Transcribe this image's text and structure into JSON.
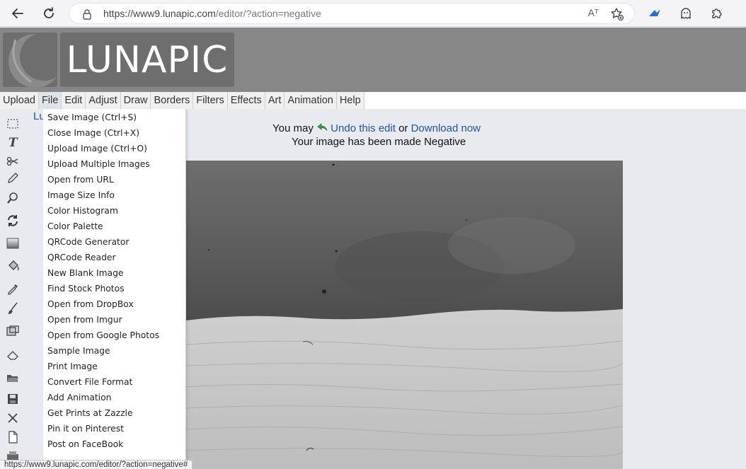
{
  "browser": {
    "url_host": "https://www9.lunapic.com",
    "url_path": "/editor/?action=negative",
    "reader_icon_text": "Aᵀ",
    "status_url": "https://www9.lunapic.com/editor/?action=negative#"
  },
  "logo": {
    "text": "LUNAPIC"
  },
  "menubar": {
    "items": [
      "Upload",
      "File",
      "Edit",
      "Adjust",
      "Draw",
      "Borders",
      "Filters",
      "Effects",
      "Art",
      "Animation",
      "Help"
    ]
  },
  "message": {
    "prefix": "You may",
    "undo_link": "Undo this edit",
    "or": "or",
    "download_link": "Download now",
    "line2": "Your image has been made Negative",
    "lu_fragment": "Lu"
  },
  "file_menu": {
    "items": [
      "Save Image (Ctrl+S)",
      "Close Image (Ctrl+X)",
      "Upload Image (Ctrl+O)",
      "Upload Multiple Images",
      "Open from URL",
      "Image Size Info",
      "Color Histogram",
      "Color Palette",
      "QRCode Generator",
      "QRCode Reader",
      "New Blank Image",
      "Find Stock Photos",
      "Open from DropBox",
      "Open from Imgur",
      "Open from Google Photos",
      "Sample Image",
      "Print Image",
      "Convert File Format",
      "Add Animation",
      "Get Prints at Zazzle",
      "Pin it on Pinterest",
      "Post on FaceBook"
    ]
  },
  "tools": [
    "select-icon",
    "text-icon",
    "scissors-icon",
    "pencil-icon",
    "zoom-icon",
    "rotate-icon",
    "gradient-icon",
    "paint-bucket-icon",
    "eyedropper-icon",
    "brush-icon",
    "crop-icon",
    "eraser-icon",
    "open-folder-icon",
    "save-disk-icon",
    "close-x-icon",
    "new-file-icon",
    "print-icon"
  ],
  "colors": {
    "header_bg": "#878787",
    "logo_bg": "#6e6e6e",
    "link": "#1f55a8",
    "page_bg": "#e8eaf0"
  }
}
